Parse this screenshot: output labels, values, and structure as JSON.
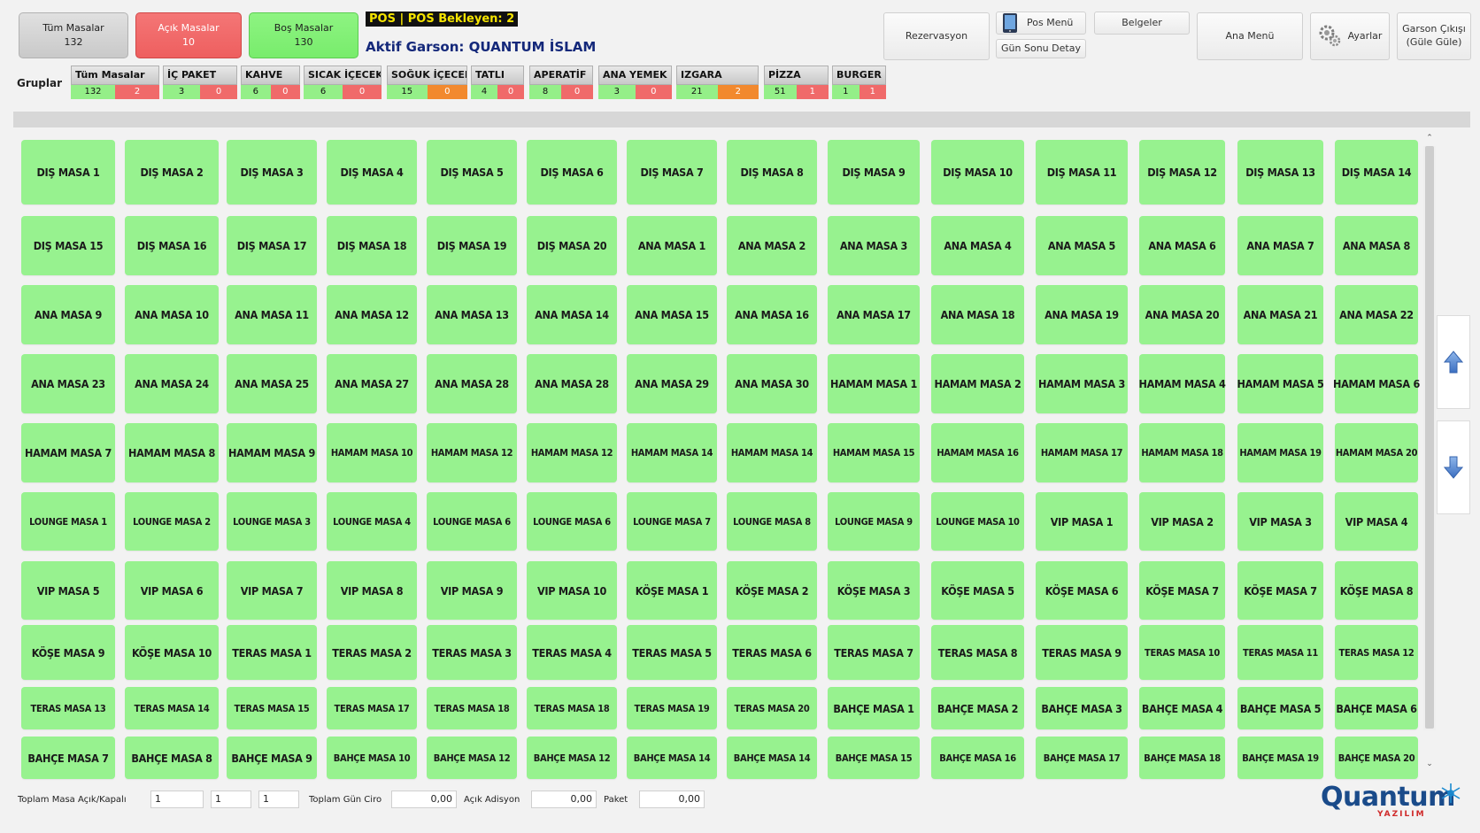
{
  "summary": {
    "all_tables": {
      "label": "Tüm Masalar",
      "count": "132"
    },
    "open_tables": {
      "label": "Açık Masalar",
      "count": "10"
    },
    "empty_tables": {
      "label": "Boş Masalar",
      "count": "130"
    }
  },
  "pos_banner": "POS | POS Bekleyen: 2",
  "active_waiter": "Aktif Garson: QUANTUM İSLAM",
  "toolbar": {
    "reservation": "Rezervasyon",
    "pos_menu": "Pos Menü",
    "day_end_detail": "Gün Sonu Detay",
    "documents": "Belgeler",
    "main_menu": "Ana Menü",
    "settings": "Ayarlar",
    "logout_line1": "Garson Çıkışı",
    "logout_line2": "(Güle Güle)"
  },
  "groups_label": "Gruplar",
  "groups": [
    {
      "name": "Tüm Masalar",
      "open": "132",
      "busy": "2"
    },
    {
      "name": "İÇ PAKET",
      "open": "3",
      "busy": "0"
    },
    {
      "name": "KAHVE",
      "open": "6",
      "busy": "0"
    },
    {
      "name": "SICAK İÇECEK",
      "open": "6",
      "busy": "0"
    },
    {
      "name": "SOĞUK İÇECEK",
      "open": "15",
      "busy": "0"
    },
    {
      "name": "TATLI",
      "open": "4",
      "busy": "0"
    },
    {
      "name": "APERATİF",
      "open": "8",
      "busy": "0"
    },
    {
      "name": "ANA YEMEK",
      "open": "3",
      "busy": "0"
    },
    {
      "name": "IZGARA",
      "open": "21",
      "busy": "2"
    },
    {
      "name": "PİZZA",
      "open": "51",
      "busy": "1"
    },
    {
      "name": "BURGER",
      "open": "1",
      "busy": "1"
    }
  ],
  "tables": [
    "DIŞ MASA 1",
    "DIŞ MASA 2",
    "DIŞ MASA 3",
    "DIŞ MASA 4",
    "DIŞ MASA 5",
    "DIŞ MASA 6",
    "DIŞ MASA 7",
    "DIŞ MASA 8",
    "DIŞ MASA 9",
    "DIŞ MASA 10",
    "DIŞ MASA 11",
    "DIŞ MASA 12",
    "DIŞ MASA 13",
    "DIŞ MASA 14",
    "DIŞ MASA 15",
    "DIŞ MASA 16",
    "DIŞ MASA 17",
    "DIŞ MASA 18",
    "DIŞ MASA 19",
    "DIŞ MASA 20",
    "ANA MASA 1",
    "ANA MASA 2",
    "ANA MASA 3",
    "ANA MASA 4",
    "ANA MASA 5",
    "ANA MASA 6",
    "ANA MASA 7",
    "ANA MASA 8",
    "ANA MASA 9",
    "ANA MASA 10",
    "ANA MASA 11",
    "ANA MASA 12",
    "ANA MASA 13",
    "ANA MASA 14",
    "ANA MASA 15",
    "ANA MASA 16",
    "ANA MASA 17",
    "ANA MASA 18",
    "ANA MASA 19",
    "ANA MASA 20",
    "ANA MASA 21",
    "ANA MASA 22",
    "ANA MASA 23",
    "ANA MASA 24",
    "ANA MASA 25",
    "ANA MASA 27",
    "ANA MASA 28",
    "ANA MASA 28",
    "ANA MASA 29",
    "ANA MASA 30",
    "HAMAM MASA 1",
    "HAMAM MASA 2",
    "HAMAM MASA 3",
    "HAMAM MASA 4",
    "HAMAM MASA 5",
    "HAMAM MASA 6",
    "HAMAM MASA 7",
    "HAMAM MASA 8",
    "HAMAM MASA 9",
    "HAMAM MASA 10",
    "HAMAM MASA 12",
    "HAMAM MASA 12",
    "HAMAM MASA 14",
    "HAMAM MASA 14",
    "HAMAM MASA 15",
    "HAMAM MASA 16",
    "HAMAM MASA 17",
    "HAMAM MASA 18",
    "HAMAM MASA 19",
    "HAMAM MASA 20",
    "LOUNGE MASA 1",
    "LOUNGE MASA 2",
    "LOUNGE MASA 3",
    "LOUNGE MASA 4",
    "LOUNGE MASA 6",
    "LOUNGE MASA 6",
    "LOUNGE MASA 7",
    "LOUNGE MASA 8",
    "LOUNGE MASA 9",
    "LOUNGE MASA 10",
    "VIP MASA 1",
    "VIP MASA 2",
    "VIP MASA 3",
    "VIP MASA 4",
    "VIP MASA 5",
    "VIP MASA 6",
    "VIP MASA 7",
    "VIP MASA 8",
    "VIP MASA 9",
    "VIP MASA 10",
    "KÖŞE MASA 1",
    "KÖŞE MASA 2",
    "KÖŞE MASA 3",
    "KÖŞE MASA 5",
    "KÖŞE MASA 6",
    "KÖŞE MASA 7",
    "KÖŞE MASA 7",
    "KÖŞE MASA 8",
    "KÖŞE MASA 9",
    "KÖŞE MASA 10",
    "TERAS MASA 1",
    "TERAS MASA 2",
    "TERAS MASA 3",
    "TERAS MASA 4",
    "TERAS MASA 5",
    "TERAS MASA 6",
    "TERAS MASA 7",
    "TERAS MASA 8",
    "TERAS MASA 9",
    "TERAS MASA 10",
    "TERAS MASA 11",
    "TERAS MASA 12",
    "TERAS MASA 13",
    "TERAS MASA 14",
    "TERAS MASA 15",
    "TERAS MASA 17",
    "TERAS MASA 18",
    "TERAS MASA 18",
    "TERAS MASA 19",
    "TERAS MASA 20",
    "BAHÇE MASA 1",
    "BAHÇE MASA 2",
    "BAHÇE MASA 3",
    "BAHÇE MASA 4",
    "BAHÇE MASA 5",
    "BAHÇE MASA 6",
    "BAHÇE MASA 7",
    "BAHÇE MASA 8",
    "BAHÇE MASA 9",
    "BAHÇE MASA 10",
    "BAHÇE MASA 12",
    "BAHÇE MASA 12",
    "BAHÇE MASA 14",
    "BAHÇE MASA 14",
    "BAHÇE MASA 15",
    "BAHÇE MASA 16",
    "BAHÇE MASA 17",
    "BAHÇE MASA 18",
    "BAHÇE MASA 19",
    "BAHÇE MASA 20"
  ],
  "footer": {
    "total_open_closed_label": "Toplam Masa Açık/Kapalı",
    "total_val1": "1",
    "total_val2": "1",
    "total_val3": "1",
    "daily_revenue_label": "Toplam Gün Ciro",
    "daily_revenue": "0,00",
    "open_checks_label": "Açık Adisyon",
    "open_checks": "0,00",
    "package_label": "Paket",
    "package": "0,00"
  },
  "brand": {
    "name": "Quantum",
    "sub": "YAZILIM"
  },
  "icons": {
    "scroll_up": "arrow-up-icon",
    "scroll_down": "arrow-down-icon",
    "settings": "gears-icon",
    "pos_menu": "tablet-icon"
  },
  "colors": {
    "table_free": "#97f28f",
    "open_red": "#f06a6a",
    "busy_orange": "#f2892e",
    "accent_blue": "#14287a"
  }
}
